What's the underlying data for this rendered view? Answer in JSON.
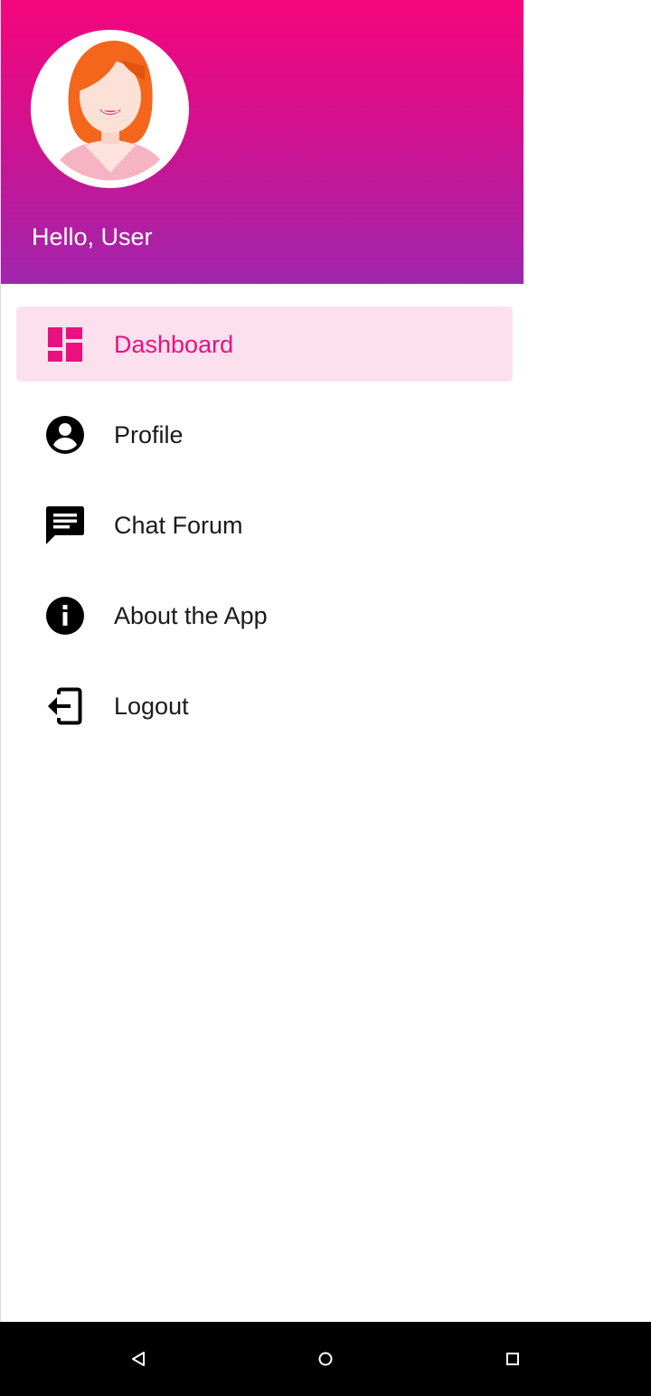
{
  "header": {
    "greeting": "Hello, User",
    "gradient_top": "#f5067c",
    "gradient_bottom": "#a026ad"
  },
  "menu": {
    "items": [
      {
        "label": "Dashboard",
        "icon": "dashboard-icon",
        "active": true
      },
      {
        "label": "Profile",
        "icon": "account-circle-icon",
        "active": false
      },
      {
        "label": "Chat Forum",
        "icon": "chat-icon",
        "active": false
      },
      {
        "label": "About the App",
        "icon": "info-icon",
        "active": false
      },
      {
        "label": "Logout",
        "icon": "logout-icon",
        "active": false
      }
    ],
    "active_color": "#e8117f",
    "active_background": "#fde0ee"
  },
  "navbar": {
    "buttons": [
      "back-icon",
      "home-icon",
      "recents-icon"
    ]
  }
}
